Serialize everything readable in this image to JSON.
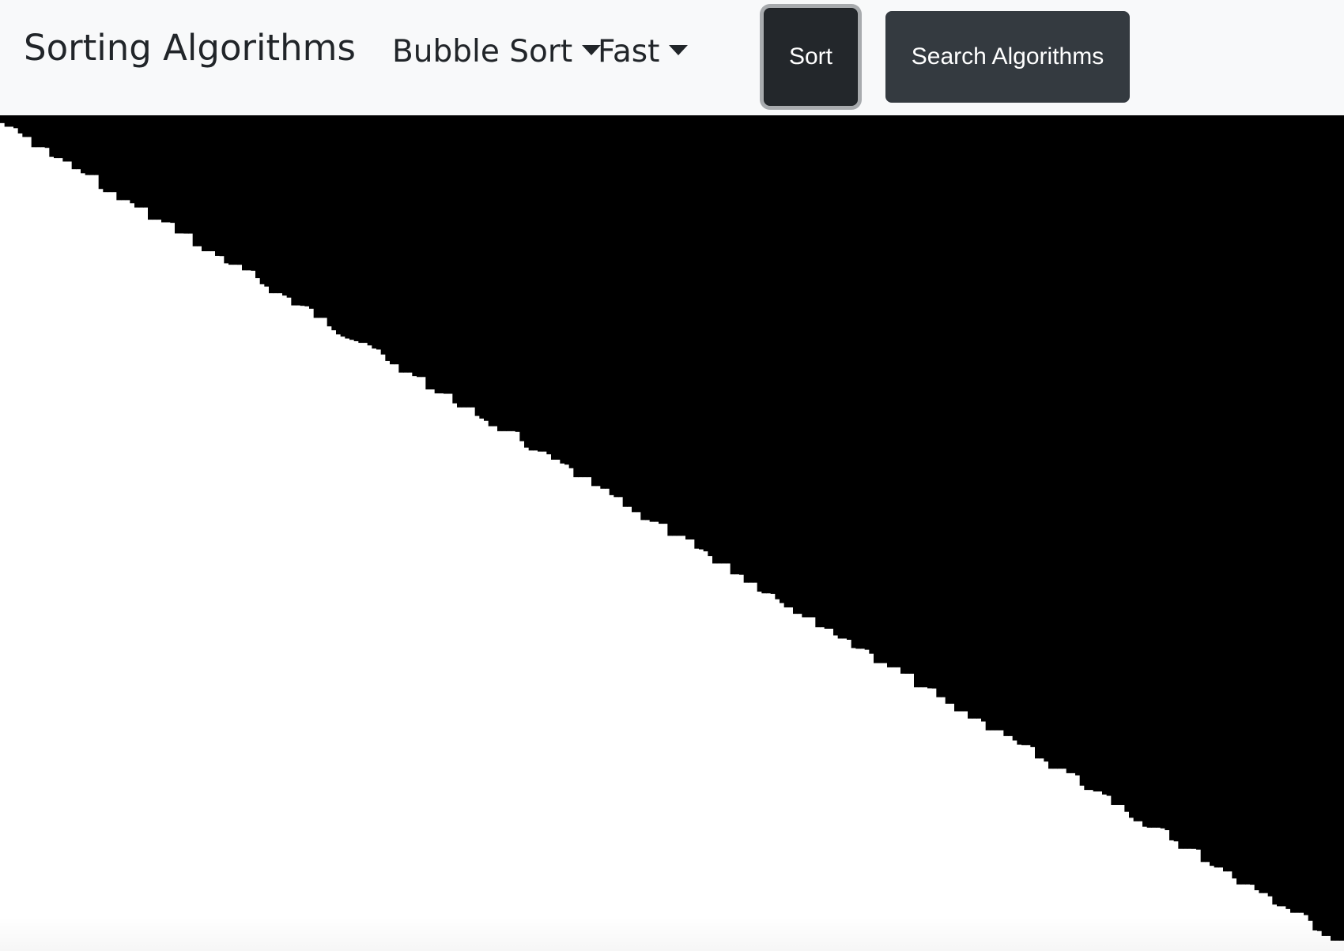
{
  "navbar": {
    "brand": "Sorting Algorithms",
    "algorithm_dropdown": {
      "selected": "Bubble Sort"
    },
    "speed_dropdown": {
      "selected": "Fast"
    },
    "sort_button": "Sort",
    "search_button": "Search Algorithms"
  },
  "visualization": {
    "bar_color": "#000000",
    "background_color": "#ffffff",
    "bar_count": 300,
    "state": "sorted ascending, each bar filled from the top"
  }
}
